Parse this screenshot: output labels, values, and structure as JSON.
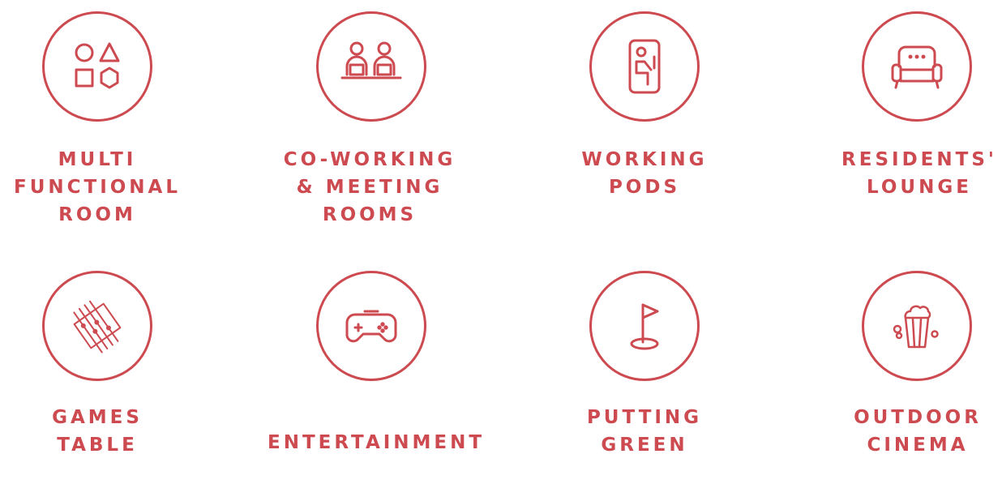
{
  "accent_color": "#cc4a50",
  "amenities": [
    {
      "icon": "shapes-icon",
      "lines": [
        "MULTI",
        "FUNCTIONAL",
        "ROOM"
      ]
    },
    {
      "icon": "coworking-people-icon",
      "lines": [
        "CO-WORKING",
        "& MEETING",
        "ROOMS"
      ]
    },
    {
      "icon": "working-pod-icon",
      "lines": [
        "WORKING",
        "PODS"
      ]
    },
    {
      "icon": "armchair-icon",
      "lines": [
        "RESIDENTS'",
        "LOUNGE"
      ]
    },
    {
      "icon": "foosball-table-icon",
      "lines": [
        "GAMES",
        "TABLE"
      ]
    },
    {
      "icon": "game-controller-icon",
      "lines": [
        "ENTERTAINMENT"
      ]
    },
    {
      "icon": "golf-flag-icon",
      "lines": [
        "PUTTING",
        "GREEN"
      ]
    },
    {
      "icon": "popcorn-icon",
      "lines": [
        "OUTDOOR",
        "CINEMA"
      ]
    }
  ]
}
